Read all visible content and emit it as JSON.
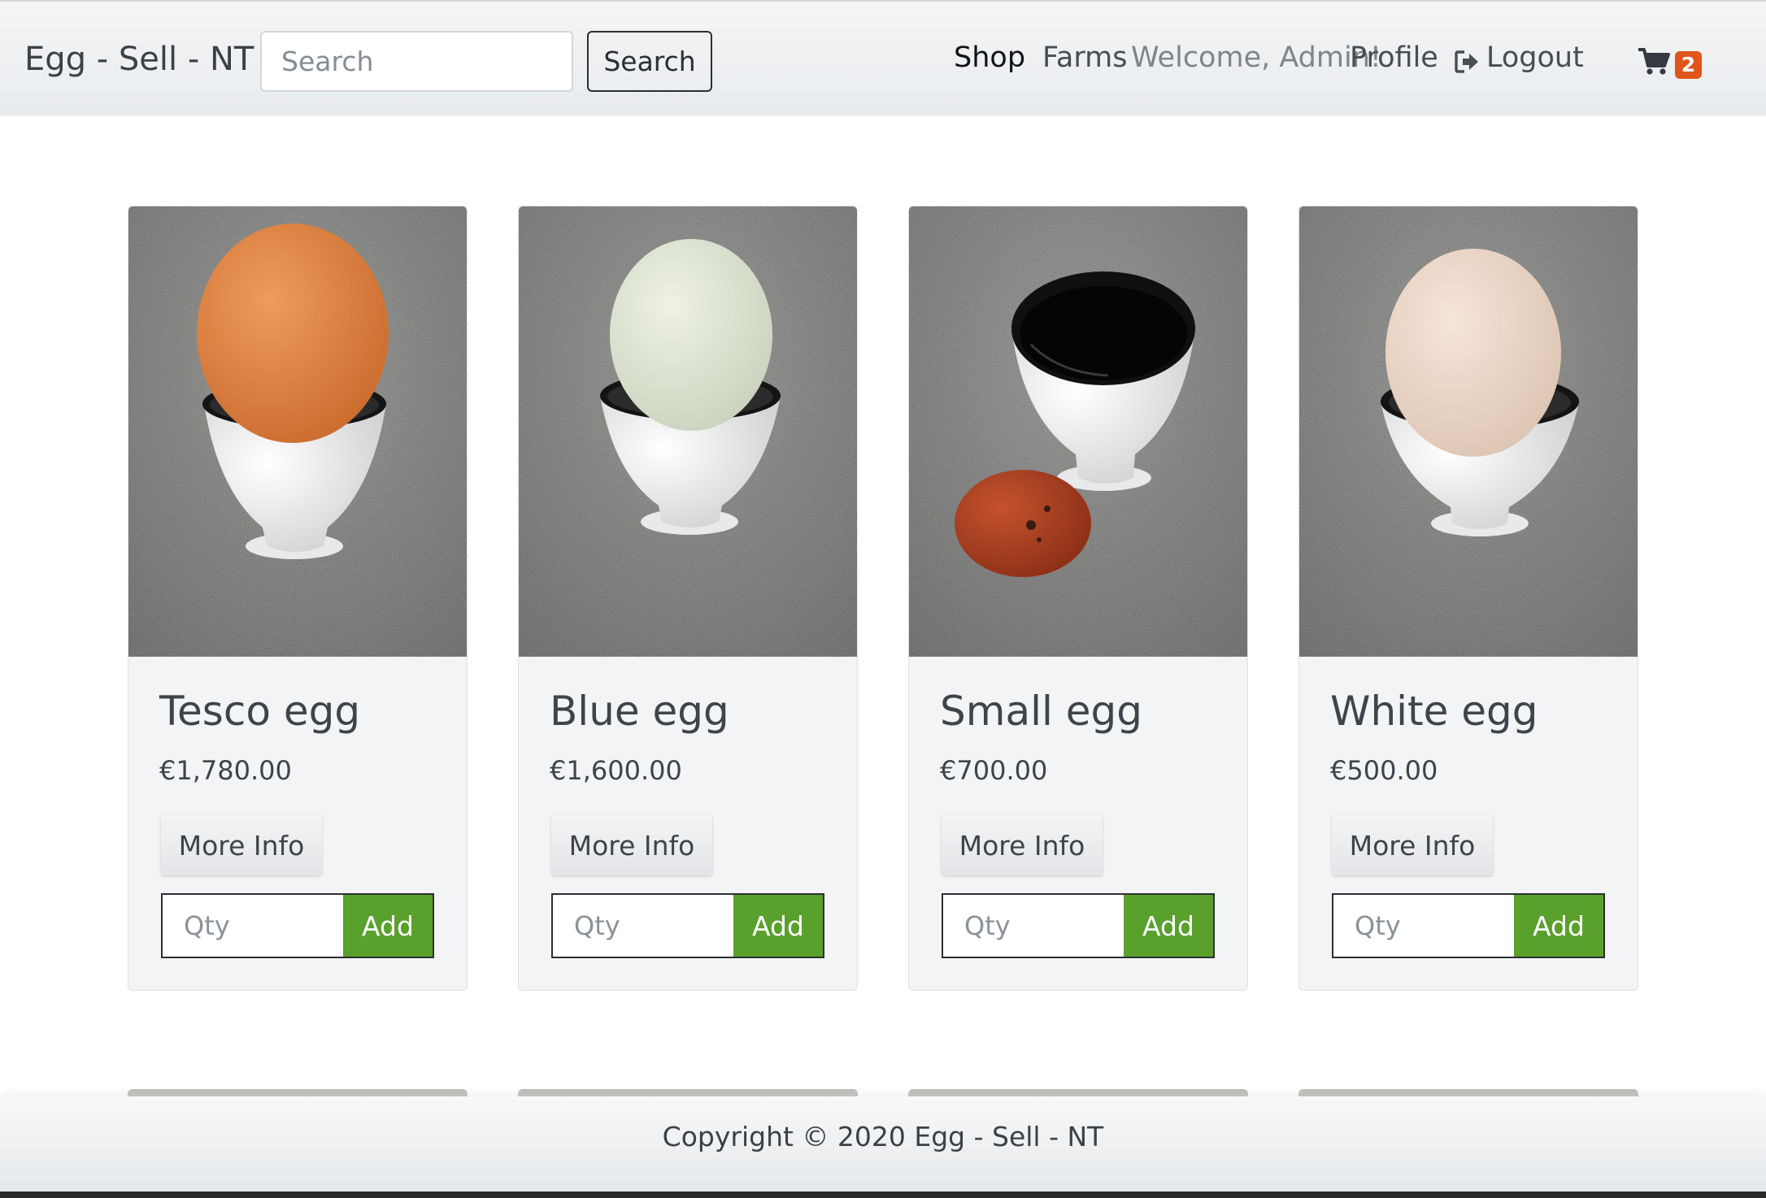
{
  "navbar": {
    "brand": "Egg - Sell - NT",
    "search_placeholder": "Search",
    "search_button": "Search",
    "links": {
      "shop": "Shop",
      "farms": "Farms",
      "welcome": "Welcome, Admin!",
      "profile": "Profile",
      "logout": "Logout"
    },
    "cart_count": "2",
    "accent_badge_color": "#e0551b"
  },
  "products": [
    {
      "name": "Tesco egg",
      "price": "€1,780.00",
      "more_label": "More Info",
      "qty_placeholder": "Qty",
      "add_label": "Add",
      "image": "brown-egg-in-cup"
    },
    {
      "name": "Blue egg",
      "price": "€1,600.00",
      "more_label": "More Info",
      "qty_placeholder": "Qty",
      "add_label": "Add",
      "image": "pale-blue-egg-in-cup"
    },
    {
      "name": "Small egg",
      "price": "€700.00",
      "more_label": "More Info",
      "qty_placeholder": "Qty",
      "add_label": "Add",
      "image": "speckled-egg-beside-empty-cup"
    },
    {
      "name": "White egg",
      "price": "€500.00",
      "more_label": "More Info",
      "qty_placeholder": "Qty",
      "add_label": "Add",
      "image": "cream-egg-in-cup"
    }
  ],
  "footer": {
    "copyright": "Copyright © 2020 Egg - Sell - NT"
  },
  "colors": {
    "add_button": "#5aa02c",
    "card_background": "#f3f4f6"
  }
}
